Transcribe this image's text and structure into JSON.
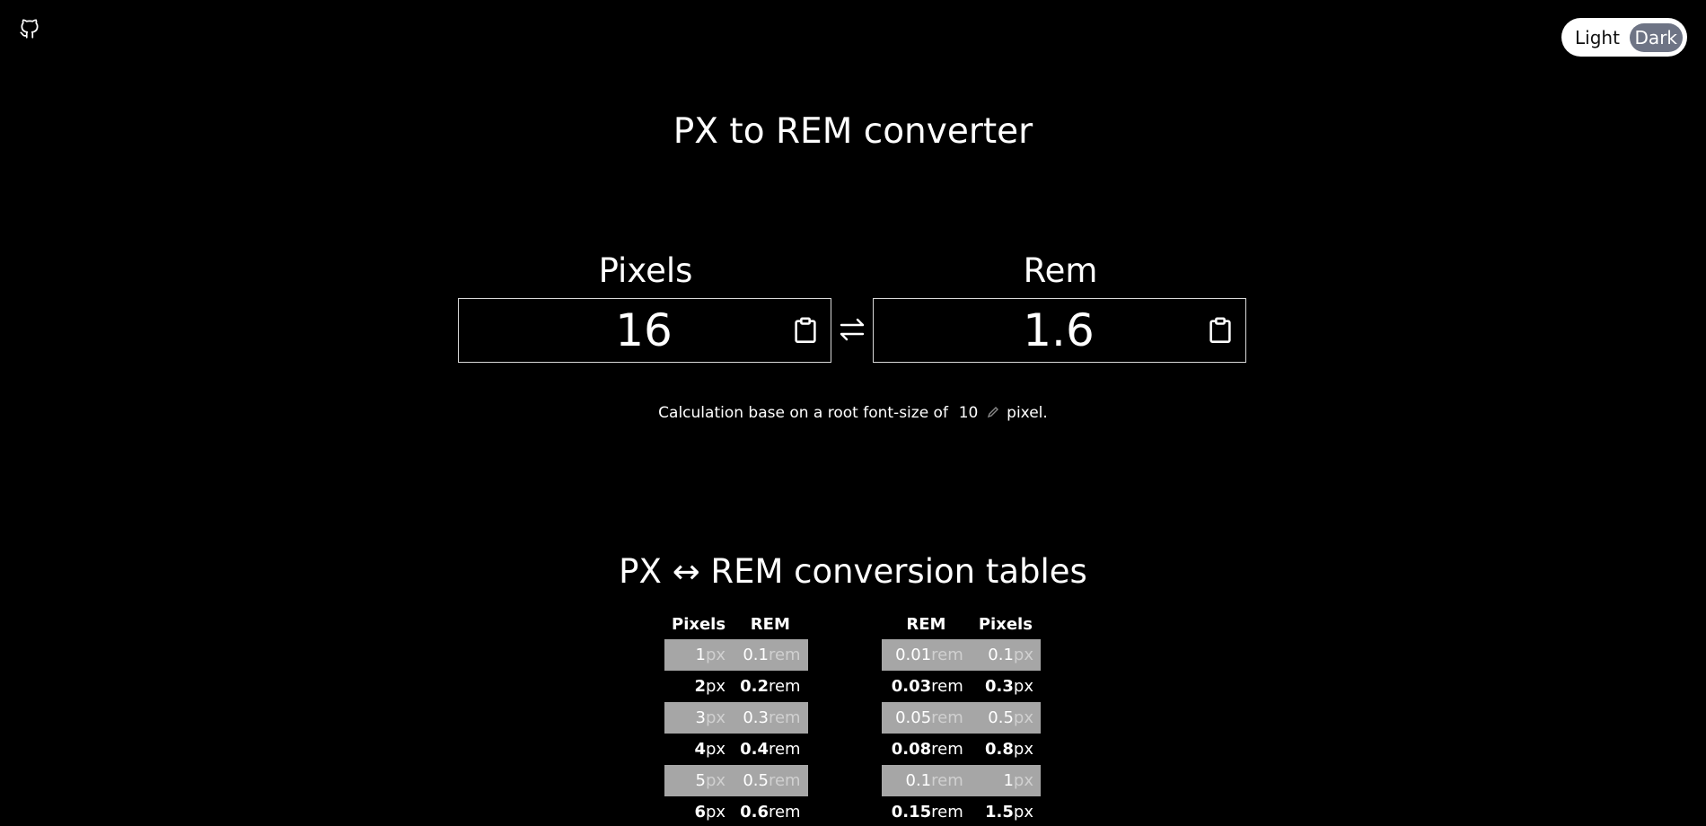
{
  "header": {
    "github_icon": "github-icon",
    "theme": {
      "light_label": "Light",
      "dark_label": "Dark",
      "active": "Dark"
    }
  },
  "title": "PX to REM converter",
  "converter": {
    "pixels_label": "Pixels",
    "pixels_value": "16",
    "rem_label": "Rem",
    "rem_value": "1.6",
    "swap_icon": "swap-arrows-icon",
    "clipboard_icon": "clipboard-icon"
  },
  "base": {
    "prefix": "Calculation base on a root font-size of",
    "value": "10",
    "suffix": "pixel."
  },
  "tables": {
    "title": "PX ↔ REM conversion tables",
    "px_to_rem": {
      "headers": [
        "Pixels",
        "REM"
      ],
      "rows": [
        {
          "px": "1",
          "px_unit": "px",
          "rem": "0.1",
          "rem_unit": "rem"
        },
        {
          "px": "2",
          "px_unit": "px",
          "rem": "0.2",
          "rem_unit": "rem"
        },
        {
          "px": "3",
          "px_unit": "px",
          "rem": "0.3",
          "rem_unit": "rem"
        },
        {
          "px": "4",
          "px_unit": "px",
          "rem": "0.4",
          "rem_unit": "rem"
        },
        {
          "px": "5",
          "px_unit": "px",
          "rem": "0.5",
          "rem_unit": "rem"
        },
        {
          "px": "6",
          "px_unit": "px",
          "rem": "0.6",
          "rem_unit": "rem"
        }
      ]
    },
    "rem_to_px": {
      "headers": [
        "REM",
        "Pixels"
      ],
      "rows": [
        {
          "rem": "0.01",
          "rem_unit": "rem",
          "px": "0.1",
          "px_unit": "px"
        },
        {
          "rem": "0.03",
          "rem_unit": "rem",
          "px": "0.3",
          "px_unit": "px"
        },
        {
          "rem": "0.05",
          "rem_unit": "rem",
          "px": "0.5",
          "px_unit": "px"
        },
        {
          "rem": "0.08",
          "rem_unit": "rem",
          "px": "0.8",
          "px_unit": "px"
        },
        {
          "rem": "0.1",
          "rem_unit": "rem",
          "px": "1",
          "px_unit": "px"
        },
        {
          "rem": "0.15",
          "rem_unit": "rem",
          "px": "1.5",
          "px_unit": "px"
        }
      ]
    }
  }
}
